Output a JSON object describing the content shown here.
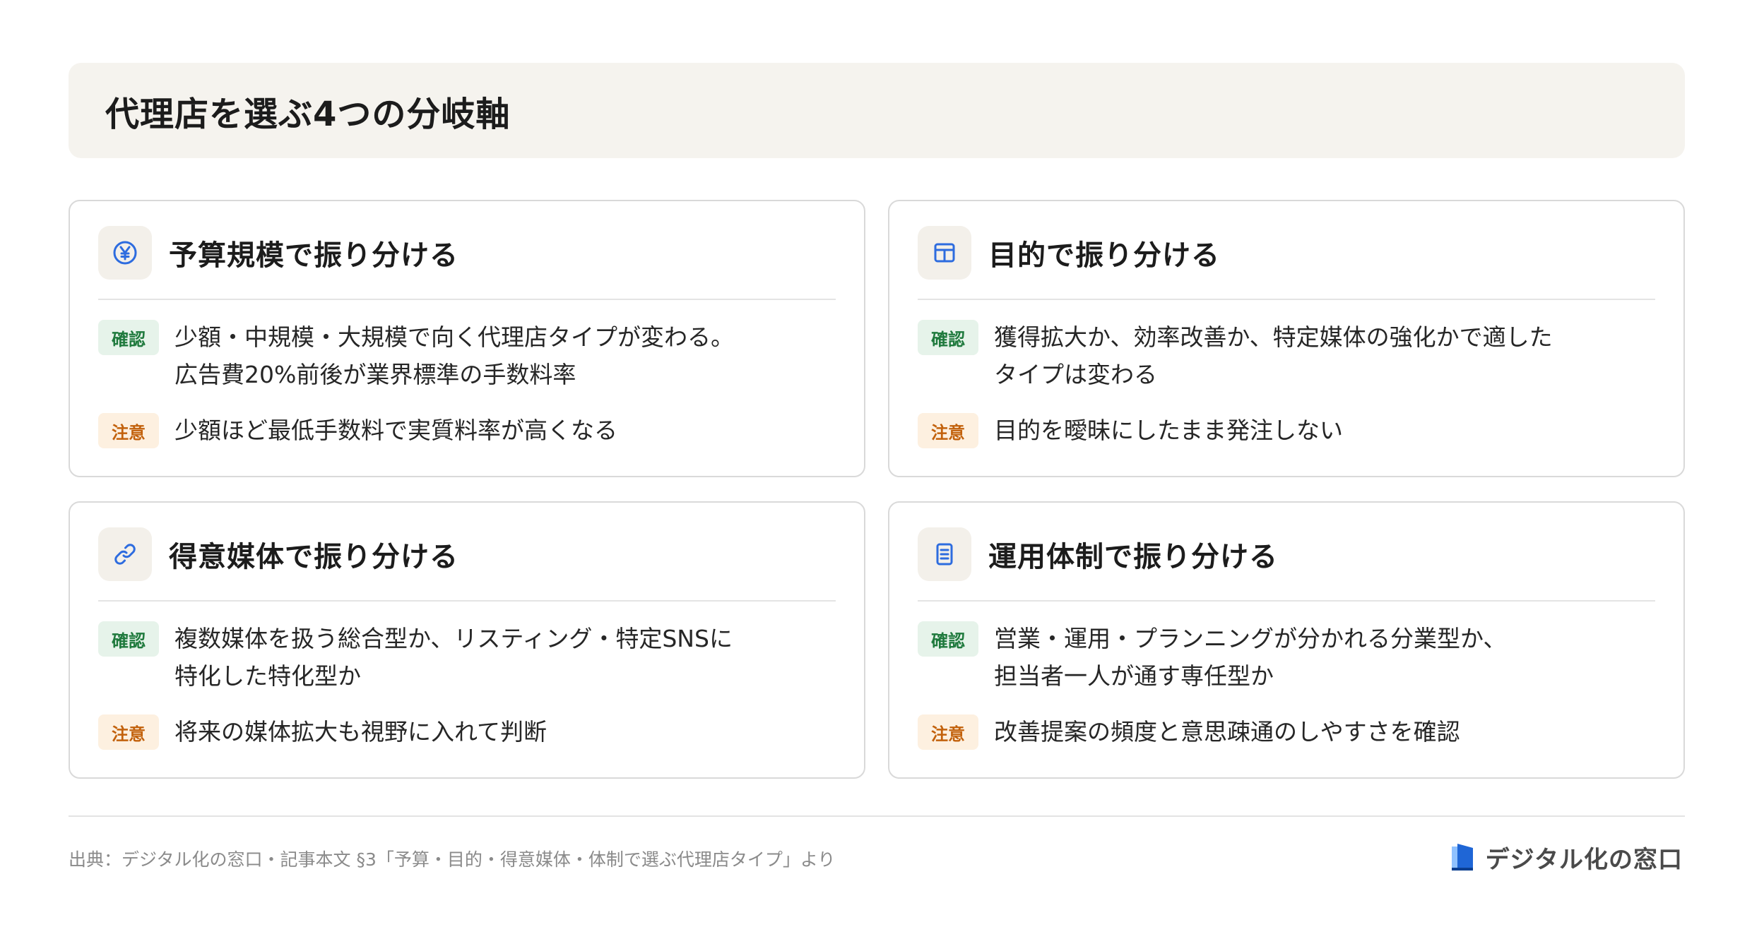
{
  "title": "代理店を選ぶ4つの分岐軸",
  "colors": {
    "accent_blue": "#2d6cdf",
    "confirm_bg": "#e6f3ea",
    "confirm_text": "#1f7a3d",
    "caution_bg": "#fdf0e0",
    "caution_text": "#c2610c",
    "title_bg": "#f5f3ee"
  },
  "cards": [
    {
      "icon": "yen-circle-icon",
      "title": "予算規模で振り分ける",
      "confirm_label": "確認",
      "confirm_text": "少額・中規模・大規模で向く代理店タイプが変わる。\n広告費20%前後が業界標準の手数料率",
      "caution_label": "注意",
      "caution_text": "少額ほど最低手数料で実質料率が高くなる"
    },
    {
      "icon": "layout-grid-icon",
      "title": "目的で振り分ける",
      "confirm_label": "確認",
      "confirm_text": "獲得拡大か、効率改善か、特定媒体の強化かで適した\nタイプは変わる",
      "caution_label": "注意",
      "caution_text": "目的を曖昧にしたまま発注しない"
    },
    {
      "icon": "link-icon",
      "title": "得意媒体で振り分ける",
      "confirm_label": "確認",
      "confirm_text": "複数媒体を扱う総合型か、リスティング・特定SNSに\n特化した特化型か",
      "caution_label": "注意",
      "caution_text": "将来の媒体拡大も視野に入れて判断"
    },
    {
      "icon": "document-icon",
      "title": "運用体制で振り分ける",
      "confirm_label": "確認",
      "confirm_text": "営業・運用・プランニングが分かれる分業型か、\n担当者一人が通す専任型か",
      "caution_label": "注意",
      "caution_text": "改善提案の頻度と意思疎通のしやすさを確認"
    }
  ],
  "footer": {
    "source": "出典：デジタル化の窓口・記事本文 §3「予算・目的・得意媒体・体制で選ぶ代理店タイプ」より",
    "brand": "デジタル化の窓口"
  }
}
